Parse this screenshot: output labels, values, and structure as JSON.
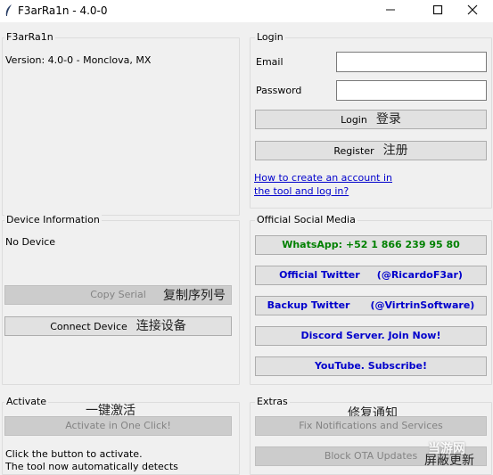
{
  "window": {
    "title": "F3arRa1n - 4.0-0",
    "minimize_glyph": "—",
    "maximize_glyph": "☐",
    "close_glyph": "✕",
    "icon": "feather-icon"
  },
  "about": {
    "group_label": "F3arRa1n",
    "version_text": "Version: 4.0-0 - Monclova, MX"
  },
  "login": {
    "group_label": "Login",
    "email_label": "Email",
    "email_value": "",
    "password_label": "Password",
    "password_value": "",
    "login_button": "Login",
    "login_cn": "登录",
    "register_button": "Register",
    "register_cn": "注册",
    "help_link_line1": "How to create an account in",
    "help_link_line2": "the tool and log in?"
  },
  "device": {
    "group_label": "Device Information",
    "status": "No Device",
    "copy_serial_button": "Copy Serial",
    "copy_serial_cn": "复制序列号",
    "connect_button": "Connect Device",
    "connect_cn": "连接设备"
  },
  "social": {
    "group_label": "Official Social Media",
    "buttons": [
      {
        "label": "WhatsApp: +52 1 866 239 95 80"
      },
      {
        "label": "Official Twitter     (@RicardoF3ar)"
      },
      {
        "label": "Backup Twitter      (@VirtrinSoftware)"
      },
      {
        "label": "Discord Server. Join Now!"
      },
      {
        "label": "YouTube. Subscribe!"
      }
    ]
  },
  "activate": {
    "group_label": "Activate",
    "cn_title": "一键激活",
    "activate_button": "Activate in One Click!",
    "info_line1": "Click the button to activate.",
    "info_line2": "The tool now automatically detects"
  },
  "extras": {
    "group_label": "Extras",
    "cn_title": "修复通知",
    "fix_button": "Fix Notifications and Services",
    "block_button": "Block OTA Updates",
    "block_cn": "屏蔽更新"
  },
  "watermark": {
    "text": "当游网"
  },
  "colors": {
    "link": "#0000cc",
    "whatsapp": "#008000",
    "social": "#0000cc"
  }
}
